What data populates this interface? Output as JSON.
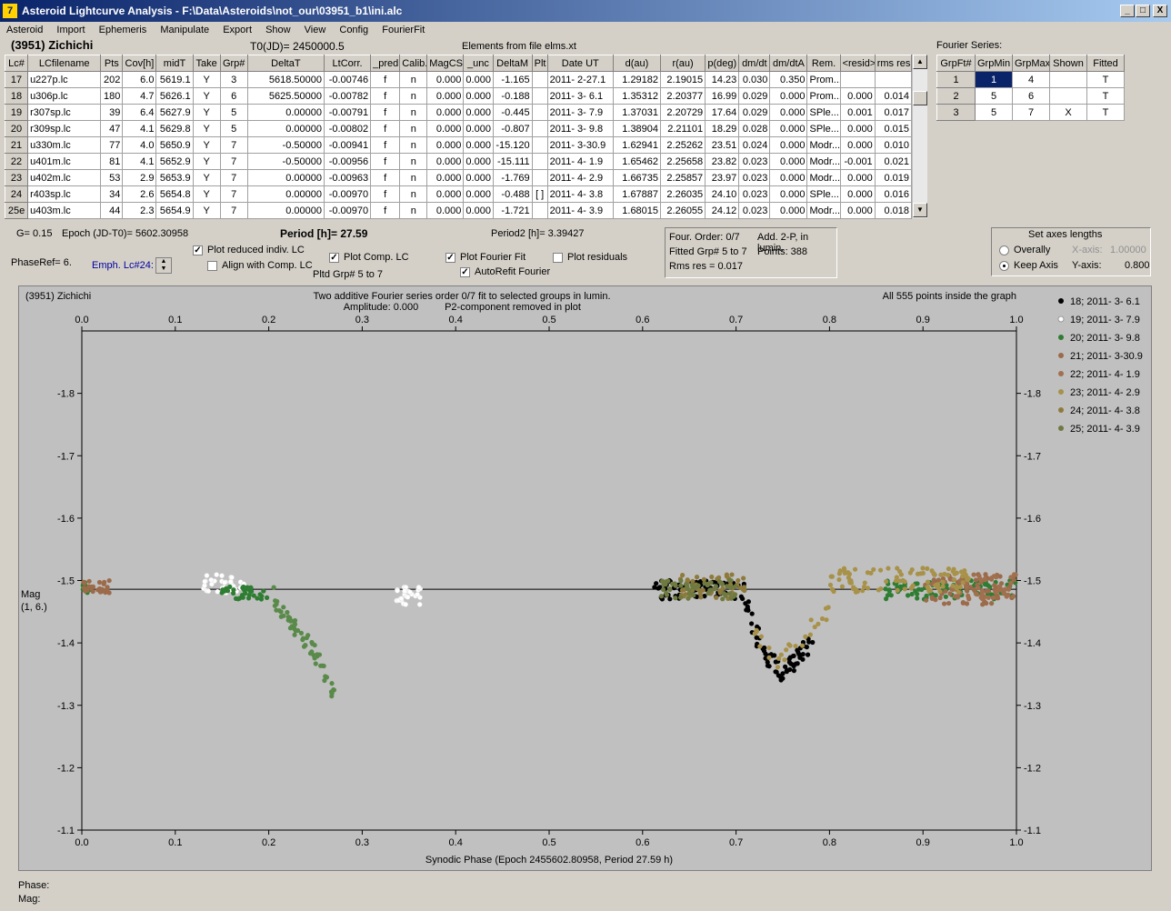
{
  "window": {
    "title": "Asteroid Lightcurve Analysis - F:\\Data\\Asteroids\\not_our\\03951_b1\\ini.alc",
    "icon": "app-icon",
    "controls": [
      "_",
      "□",
      "X"
    ]
  },
  "menu": [
    "Asteroid",
    "Import",
    "Ephemeris",
    "Manipulate",
    "Export",
    "Show",
    "View",
    "Config",
    "FourierFit"
  ],
  "header": {
    "asteroid": "(3951) Zichichi",
    "t0": "T0(JD)= 2450000.5",
    "elements": "Elements from file elms.xt",
    "fourier_title": "Fourier Series:"
  },
  "table": {
    "columns": [
      "Lc#",
      "LCfilename",
      "Pts",
      "Cov[h]",
      "midT",
      "Take",
      "Grp#",
      "DeltaT",
      "LtCorr.",
      "_pred.",
      "Calib.",
      "MagCS",
      "_unc",
      "DeltaM",
      "Plt",
      "Date UT",
      "d(au)",
      "r(au)",
      "p(deg)",
      "dm/dt",
      "dm/dtA",
      "Rem.",
      "<resid>",
      "rms res"
    ],
    "rows": [
      [
        "17",
        "u227p.lc",
        "202",
        "6.0",
        "5619.1",
        "Y",
        "3",
        "5618.50000",
        "-0.00746",
        "f",
        "n",
        "0.000",
        "0.000",
        "-1.165",
        "",
        "2011- 2-27.1",
        "1.29182",
        "2.19015",
        "14.23",
        "0.030",
        "0.350",
        "Prom...",
        "",
        ""
      ],
      [
        "18",
        "u306p.lc",
        "180",
        "4.7",
        "5626.1",
        "Y",
        "6",
        "5625.50000",
        "-0.00782",
        "f",
        "n",
        "0.000",
        "0.000",
        "-0.188",
        "",
        "2011- 3- 6.1",
        "1.35312",
        "2.20377",
        "16.99",
        "0.029",
        "0.000",
        "Prom...",
        "0.000",
        "0.014"
      ],
      [
        "19",
        "r307sp.lc",
        "39",
        "6.4",
        "5627.9",
        "Y",
        "5",
        "0.00000",
        "-0.00791",
        "f",
        "n",
        "0.000",
        "0.000",
        "-0.445",
        "",
        "2011- 3- 7.9",
        "1.37031",
        "2.20729",
        "17.64",
        "0.029",
        "0.000",
        "SPle...",
        "0.001",
        "0.017"
      ],
      [
        "20",
        "r309sp.lc",
        "47",
        "4.1",
        "5629.8",
        "Y",
        "5",
        "0.00000",
        "-0.00802",
        "f",
        "n",
        "0.000",
        "0.000",
        "-0.807",
        "",
        "2011- 3- 9.8",
        "1.38904",
        "2.21101",
        "18.29",
        "0.028",
        "0.000",
        "SPle...",
        "0.000",
        "0.015"
      ],
      [
        "21",
        "u330m.lc",
        "77",
        "4.0",
        "5650.9",
        "Y",
        "7",
        "-0.50000",
        "-0.00941",
        "f",
        "n",
        "0.000",
        "0.000",
        "-15.120",
        "",
        "2011- 3-30.9",
        "1.62941",
        "2.25262",
        "23.51",
        "0.024",
        "0.000",
        "Modr...",
        "0.000",
        "0.010"
      ],
      [
        "22",
        "u401m.lc",
        "81",
        "4.1",
        "5652.9",
        "Y",
        "7",
        "-0.50000",
        "-0.00956",
        "f",
        "n",
        "0.000",
        "0.000",
        "-15.111",
        "",
        "2011- 4- 1.9",
        "1.65462",
        "2.25658",
        "23.82",
        "0.023",
        "0.000",
        "Modr...",
        "-0.001",
        "0.021"
      ],
      [
        "23",
        "u402m.lc",
        "53",
        "2.9",
        "5653.9",
        "Y",
        "7",
        "0.00000",
        "-0.00963",
        "f",
        "n",
        "0.000",
        "0.000",
        "-1.769",
        "",
        "2011- 4- 2.9",
        "1.66735",
        "2.25857",
        "23.97",
        "0.023",
        "0.000",
        "Modr...",
        "0.000",
        "0.019"
      ],
      [
        "24",
        "r403sp.lc",
        "34",
        "2.6",
        "5654.8",
        "Y",
        "7",
        "0.00000",
        "-0.00970",
        "f",
        "n",
        "0.000",
        "0.000",
        "-0.488",
        "[ ]",
        "2011- 4- 3.8",
        "1.67887",
        "2.26035",
        "24.10",
        "0.023",
        "0.000",
        "SPle...",
        "0.000",
        "0.016"
      ],
      [
        "25e",
        "u403m.lc",
        "44",
        "2.3",
        "5654.9",
        "Y",
        "7",
        "0.00000",
        "-0.00970",
        "f",
        "n",
        "0.000",
        "0.000",
        "-1.721",
        "",
        "2011- 4- 3.9",
        "1.68015",
        "2.26055",
        "24.12",
        "0.023",
        "0.000",
        "Modr...",
        "0.000",
        "0.018"
      ]
    ]
  },
  "fourier": {
    "columns": [
      "GrpFt#",
      "GrpMin",
      "GrpMax",
      "Shown",
      "Fitted"
    ],
    "rows": [
      [
        "1",
        "1",
        "4",
        "",
        "T"
      ],
      [
        "2",
        "5",
        "6",
        "",
        "T"
      ],
      [
        "3",
        "5",
        "7",
        "X",
        "T"
      ]
    ]
  },
  "info": {
    "g": "G= 0.15",
    "epoch": "Epoch (JD-T0)= 5602.30958",
    "period": "Period [h]= 27.59",
    "period2": "Period2 [h]= 3.39427",
    "phaseref": "PhaseRef= 6.",
    "emph": "Emph. Lc#24:",
    "pltd": "Pltd Grp#  5  to  7",
    "four_order": "Four. Order:  0/7",
    "add": "Add. 2-P, in lumin.",
    "fitted": "Fitted Grp# 5 to 7",
    "points": "Points: 388",
    "rms": "Rms res     = 0.017"
  },
  "checks": {
    "plot_reduced": "Plot reduced indiv. LC",
    "align": "Align with Comp. LC",
    "plot_comp": "Plot Comp. LC",
    "plot_fourier": "Plot Fourier Fit",
    "autorefit": "AutoRefit Fourier",
    "plot_resid": "Plot residuals",
    "check_mark": "✓"
  },
  "axes_box": {
    "title": "Set axes lengths",
    "overally": "Overally",
    "keep": "Keep Axis",
    "xaxis": "X-axis:",
    "xval": "1.00000",
    "yaxis": "Y-axis:",
    "yval": "0.800"
  },
  "chart_data": {
    "type": "scatter",
    "title": "Two additive Fourier series order 0/7 fit to selected groups in lumin.",
    "subtitle_amp": "Amplitude: 0.000",
    "subtitle_p2": "P2-component removed in plot",
    "left_label": "(3951) Zichichi",
    "right_label": "All 555 points inside the graph",
    "xlabel": "Synodic Phase (Epoch 2455602.80958, Period 27.59 h)",
    "ylabel": "Mag",
    "ylabel2": "(1, 6.)",
    "xlim": [
      0,
      1
    ],
    "ylim": [
      -1.9,
      -1.1
    ],
    "y_reversed": true,
    "xticks": [
      "0.0",
      "0.1",
      "0.2",
      "0.3",
      "0.4",
      "0.5",
      "0.6",
      "0.7",
      "0.8",
      "0.9",
      "1.0"
    ],
    "yticks": [
      "-1.8",
      "-1.7",
      "-1.6",
      "-1.5",
      "-1.4",
      "-1.3",
      "-1.2",
      "-1.1"
    ],
    "fit_line_mag": -1.486,
    "legend_position": "right",
    "series": [
      {
        "name": "18; 2011- 3- 6.1",
        "color": "#000000",
        "ranges": [
          [
            0.612,
            0.713,
            -1.5,
            -1.47
          ]
        ]
      },
      {
        "name": "19; 2011- 3- 7.9",
        "color": "#ffffff",
        "ranges": [
          [
            0.13,
            0.175,
            -1.51,
            -1.48
          ],
          [
            0.335,
            0.365,
            -1.49,
            -1.46
          ]
        ]
      },
      {
        "name": "20; 2011- 3- 9.8",
        "color": "#2e7d32",
        "ranges": [
          [
            0.0,
            0.01,
            -1.5,
            -1.48
          ],
          [
            0.15,
            0.2,
            -1.49,
            -1.47
          ],
          [
            0.86,
            1.0,
            -1.5,
            -1.47
          ]
        ]
      },
      {
        "name": "21; 2011- 3-30.9",
        "color": "#9b6b4a",
        "ranges": [
          [
            0.0,
            0.03,
            -1.5,
            -1.48
          ],
          [
            0.9,
            1.0,
            -1.51,
            -1.46
          ]
        ]
      },
      {
        "name": "22; 2011- 4- 1.9",
        "color": "#a0704f",
        "ranges": [
          [
            0.93,
            1.0,
            -1.51,
            -1.47
          ]
        ]
      },
      {
        "name": "23; 2011- 4- 2.9",
        "color": "#a8924a",
        "ranges": [
          [
            0.8,
            0.95,
            -1.52,
            -1.48
          ]
        ]
      },
      {
        "name": "24; 2011- 4- 3.8",
        "color": "#8e7a3c",
        "ranges": [
          [
            0.64,
            0.71,
            -1.51,
            -1.47
          ]
        ]
      },
      {
        "name": "25; 2011- 4- 3.9",
        "color": "#6e7a40",
        "ranges": [
          [
            0.62,
            0.7,
            -1.5,
            -1.47
          ]
        ]
      }
    ],
    "features": {
      "green_decline": [
        [
          0.2,
          -1.48
        ],
        [
          0.225,
          -1.43
        ],
        [
          0.25,
          -1.38
        ],
        [
          0.27,
          -1.32
        ]
      ],
      "black_dip": [
        [
          0.71,
          -1.47
        ],
        [
          0.73,
          -1.38
        ],
        [
          0.75,
          -1.35
        ],
        [
          0.78,
          -1.4
        ]
      ]
    }
  },
  "footer": {
    "phase": "Phase:",
    "mag": "Mag:"
  }
}
